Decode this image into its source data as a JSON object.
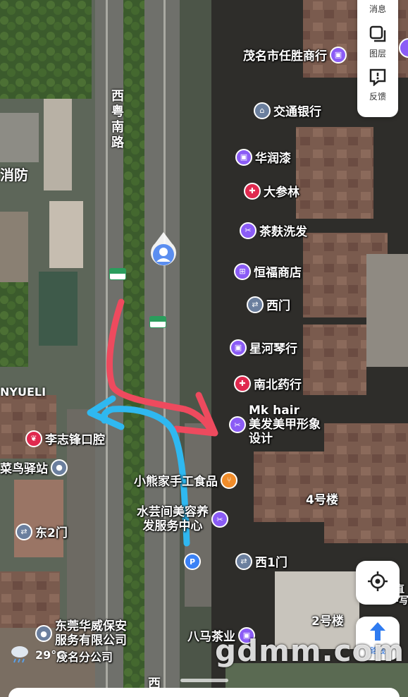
{
  "toolbar": {
    "message_label": "消息",
    "layers_label": "图层",
    "feedback_label": "反馈"
  },
  "roads": {
    "xiyue_south": "西粤南路",
    "bottom_cut": "西"
  },
  "pois": {
    "renSheng": "茂名市任胜商行",
    "bank": "交通银行",
    "huarun": "华润漆",
    "dashen": "大参林",
    "chafu": "茶麸洗发",
    "hengfu": "恒福商店",
    "ximen": "西门",
    "xinghe": "星河琴行",
    "nanbei": "南北药行",
    "mkhair": [
      "Mk hair",
      "美发美甲形象",
      "设计"
    ],
    "lizhifeng": "李志锋口腔",
    "cainiao": "菜鸟驿站",
    "xiaoxiong": "小熊家手工食品",
    "building4": "4号楼",
    "shuiyun": [
      "水芸间美容养",
      "发服务中心"
    ],
    "dong2men": "东2门",
    "xi1men": "西1门",
    "dongguan": [
      "东莞华威保安",
      "服务有限公司"
    ],
    "building2": "2号楼",
    "bama": "八马茶业",
    "xiaofang": "消防",
    "yuel": "NYUELI",
    "maomingfen": "茂名分公司",
    "edge_right": "直\n-写"
  },
  "weather": {
    "temp": "29°C"
  },
  "route_button_label": "路线",
  "watermark": "gdmm.com",
  "colors": {
    "poi_purple": "#8b5cf6",
    "poi_red": "#e0294f",
    "poi_orange": "#f08c2a",
    "poi_blue": "#3b82f6",
    "poi_gray": "#6b7f9e",
    "route_red": "#ee4a5e",
    "route_blue": "#2fb8f0"
  }
}
